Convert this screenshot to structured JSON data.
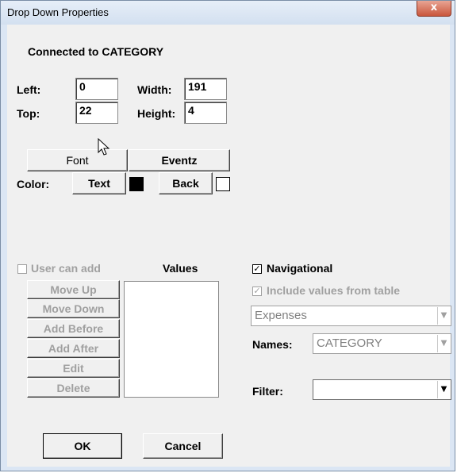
{
  "window": {
    "title": "Drop Down Properties",
    "close_symbol": "x"
  },
  "header": {
    "connected_label": "Connected to CATEGORY"
  },
  "position": {
    "left_label": "Left:",
    "left_value": "0",
    "top_label": "Top:",
    "top_value": "22",
    "width_label": "Width:",
    "width_value": "191",
    "height_label": "Height:",
    "height_value": "4"
  },
  "buttons": {
    "font_label": "Font",
    "events_label": "Eventz",
    "color_label": "Color:",
    "text_label": "Text",
    "back_label": "Back",
    "text_color": "#000000",
    "back_color": "#ffffff"
  },
  "values_section": {
    "user_can_add_label": "User can add",
    "values_label": "Values",
    "move_up_label": "Move Up",
    "move_down_label": "Move Down",
    "add_before_label": "Add Before",
    "add_after_label": "Add After",
    "edit_label": "Edit",
    "delete_label": "Delete"
  },
  "navigation": {
    "navigational_label": "Navigational",
    "navigational_checked": true,
    "include_values_label": "Include values from table",
    "include_values_checked": true,
    "table_value": "Expenses",
    "names_label": "Names:",
    "names_value": "CATEGORY",
    "filter_label": "Filter:",
    "filter_value": ""
  },
  "footer": {
    "ok_label": "OK",
    "cancel_label": "Cancel"
  },
  "icons": [
    "close-icon",
    "dropdown-arrow-icon",
    "checkmark-icon",
    "mouse-pointer-icon"
  ]
}
